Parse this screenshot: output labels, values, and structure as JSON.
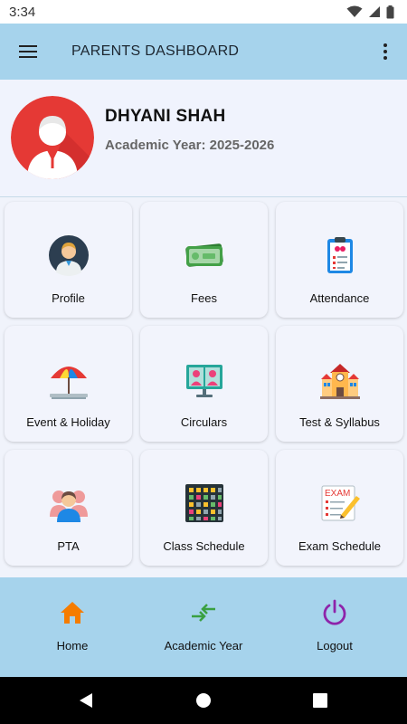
{
  "status_bar": {
    "time": "3:34"
  },
  "app_bar": {
    "title": "PARENTS DASHBOARD"
  },
  "profile": {
    "name": "DHYANI SHAH",
    "academic_year": "Academic Year: 2025-2026"
  },
  "tiles": [
    {
      "label": "Profile",
      "icon": "person-icon"
    },
    {
      "label": "Fees",
      "icon": "banknote-icon"
    },
    {
      "label": "Attendance",
      "icon": "clipboard-icon"
    },
    {
      "label": "Event & Holiday",
      "icon": "umbrella-icon"
    },
    {
      "label": "Circulars",
      "icon": "presentation-board-icon"
    },
    {
      "label": "Test & Syllabus",
      "icon": "school-building-icon"
    },
    {
      "label": "PTA",
      "icon": "group-icon"
    },
    {
      "label": "Class Schedule",
      "icon": "calendar-grid-icon"
    },
    {
      "label": "Exam Schedule",
      "icon": "exam-paper-icon"
    }
  ],
  "bottom_nav": [
    {
      "label": "Home",
      "icon": "home-icon",
      "color": "#f57c00"
    },
    {
      "label": "Academic Year",
      "icon": "swap-arrows-icon",
      "color": "#3aa041"
    },
    {
      "label": "Logout",
      "icon": "power-icon",
      "color": "#8e24aa"
    }
  ],
  "colors": {
    "app_bar": "#a6d3ec",
    "background": "#f0f3fb",
    "avatar": "#e53935"
  }
}
